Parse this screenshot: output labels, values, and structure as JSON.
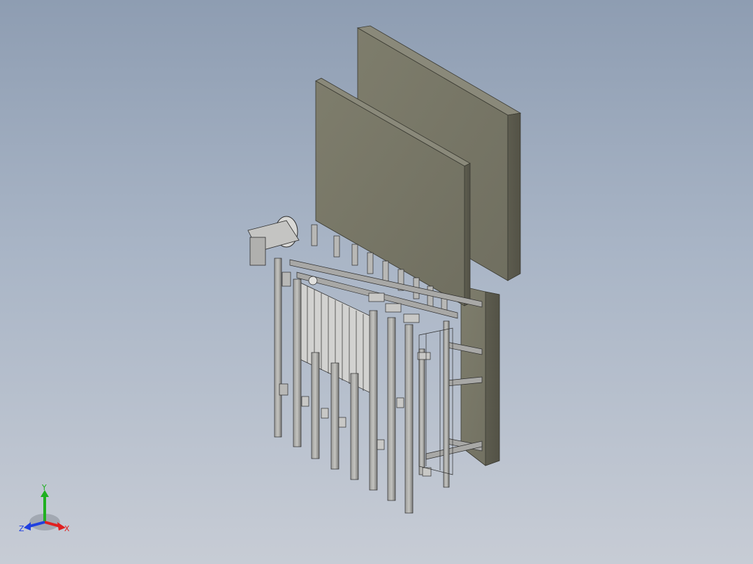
{
  "viewport": {
    "background_top": "#8e9db2",
    "background_bottom": "#c7ccd5"
  },
  "model": {
    "panel_color": "#7b7a6a",
    "panel_edge_color": "#3c3c34",
    "frame_color": "#8a8a8a"
  },
  "triad": {
    "x_label": "X",
    "y_label": "Y",
    "z_label": "Z",
    "x_color": "#e02020",
    "y_color": "#20b020",
    "z_color": "#2040e0"
  }
}
